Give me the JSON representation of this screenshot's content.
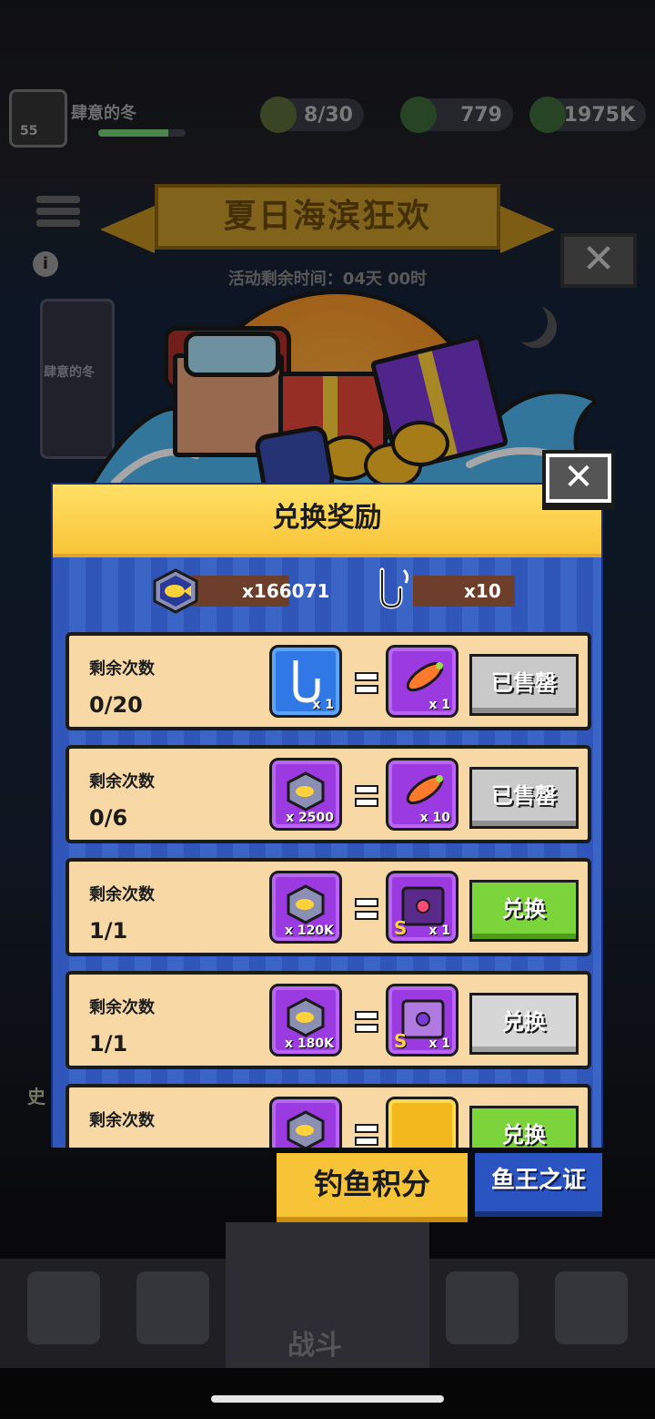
{
  "topbar": {
    "player_name": "肆意的冬",
    "level": "55",
    "res1": "8/30",
    "res2": "779",
    "res3": "1975K"
  },
  "event": {
    "title": "夏日海滨狂欢",
    "time_remaining": "活动剩余时间：04天 00时",
    "side_card_label": "肆意的冬",
    "info_icon": "ⅰ",
    "close_glyph": "✕",
    "battle_label": "战斗",
    "side_letter": "史"
  },
  "dialog": {
    "title": "兑换奖励",
    "close_glyph": "✕",
    "balance_fish": "x166071",
    "balance_hook": "x10",
    "rows": [
      {
        "label": "剩余次数",
        "count": "0/20",
        "cost_qty": "x 1",
        "reward_qty": "x 1",
        "button": "已售罄"
      },
      {
        "label": "剩余次数",
        "count": "0/6",
        "cost_qty": "x 2500",
        "reward_qty": "x 10",
        "button": "已售罄"
      },
      {
        "label": "剩余次数",
        "count": "1/1",
        "cost_qty": "x 120K",
        "reward_qty": "x 1",
        "reward_tier": "S",
        "button": "兑换"
      },
      {
        "label": "剩余次数",
        "count": "1/1",
        "cost_qty": "x 180K",
        "reward_qty": "x 1",
        "reward_tier": "S",
        "button": "兑换"
      },
      {
        "label": "剩余次数",
        "count": "",
        "cost_qty": "",
        "reward_qty": "",
        "button": "兑换"
      }
    ]
  },
  "tabs": {
    "active": "钓鱼积分",
    "inactive": "鱼王之证"
  },
  "colors": {
    "dialog_blue": "#2f56b8",
    "header_yellow": "#f8c437",
    "row_bg": "#f8d9a6",
    "button_green": "#7ad43a",
    "button_gray": "#c9c9c9"
  }
}
